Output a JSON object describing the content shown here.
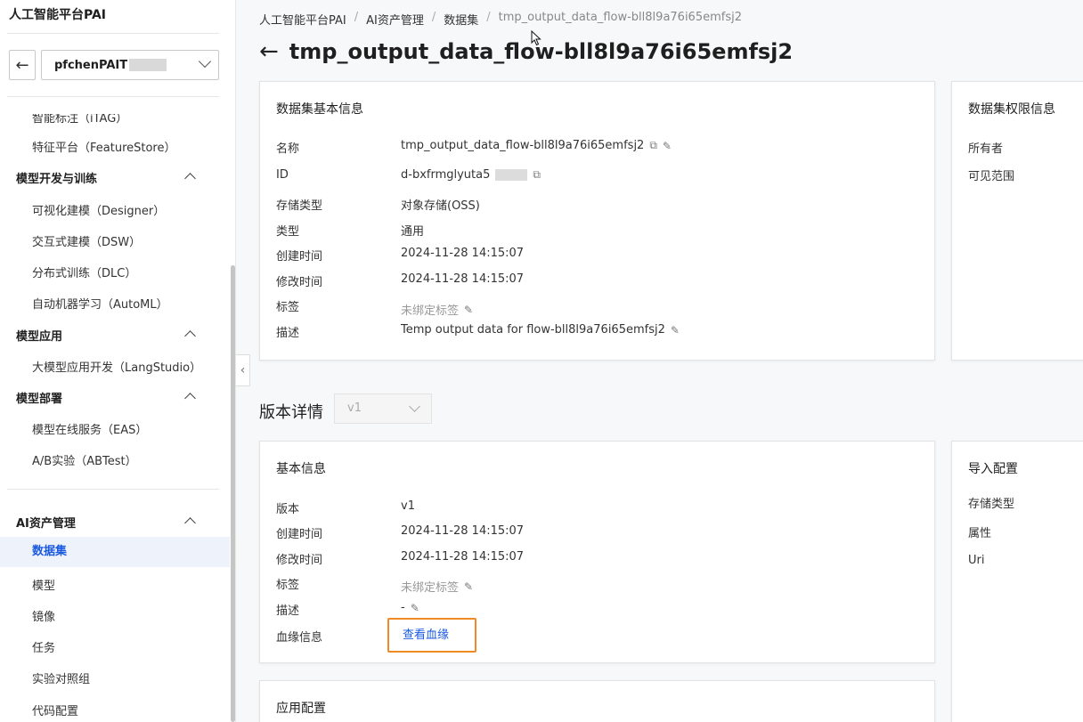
{
  "sidebar": {
    "title": "人工智能平台PAI",
    "workspace": "pfchenPAIT",
    "items_top": [
      {
        "label": "智能标注（iTAG）"
      },
      {
        "label": "特征平台（FeatureStore）"
      }
    ],
    "groups": [
      {
        "label": "模型开发与训练",
        "items": [
          "可视化建模（Designer）",
          "交互式建模（DSW）",
          "分布式训练（DLC）",
          "自动机器学习（AutoML）"
        ]
      },
      {
        "label": "模型应用",
        "items": [
          "大模型应用开发（LangStudio）"
        ]
      },
      {
        "label": "模型部署",
        "items": [
          "模型在线服务（EAS）",
          "A/B实验（ABTest）"
        ]
      },
      {
        "label": "AI资产管理",
        "items": [
          "数据集",
          "模型",
          "镜像",
          "任务",
          "实验对照组",
          "代码配置"
        ]
      }
    ]
  },
  "breadcrumb": [
    "人工智能平台PAI",
    "AI资产管理",
    "数据集",
    "tmp_output_data_flow-bll8l9a76i65emfsj2"
  ],
  "page_title": "tmp_output_data_flow-bll8l9a76i65emfsj2",
  "basic_info": {
    "title": "数据集基本信息",
    "rows": [
      {
        "label": "名称",
        "value": "tmp_output_data_flow-bll8l9a76i65emfsj2"
      },
      {
        "label": "ID",
        "value": "d-bxfrmglyuta5"
      },
      {
        "label": "存储类型",
        "value": "对象存储(OSS)"
      },
      {
        "label": "类型",
        "value": "通用"
      },
      {
        "label": "创建时间",
        "value": "2024-11-28 14:15:07"
      },
      {
        "label": "修改时间",
        "value": "2024-11-28 14:15:07"
      },
      {
        "label": "标签",
        "value": "未绑定标签"
      },
      {
        "label": "描述",
        "value": "Temp output data for flow-bll8l9a76i65emfsj2"
      }
    ]
  },
  "permission_info": {
    "title": "数据集权限信息",
    "rows": [
      "所有者",
      "可见范围"
    ]
  },
  "version_details": {
    "title": "版本详情",
    "selected_version": "v1"
  },
  "version_basic": {
    "title": "基本信息",
    "rows": [
      {
        "label": "版本",
        "value": "v1"
      },
      {
        "label": "创建时间",
        "value": "2024-11-28 14:15:07"
      },
      {
        "label": "修改时间",
        "value": "2024-11-28 14:15:07"
      },
      {
        "label": "标签",
        "value": "未绑定标签"
      },
      {
        "label": "描述",
        "value": "-"
      },
      {
        "label": "血缘信息",
        "value": "查看血缘"
      }
    ]
  },
  "import_config": {
    "title": "导入配置",
    "rows": [
      "存储类型",
      "属性",
      "Uri"
    ]
  },
  "app_config": {
    "title": "应用配置"
  }
}
